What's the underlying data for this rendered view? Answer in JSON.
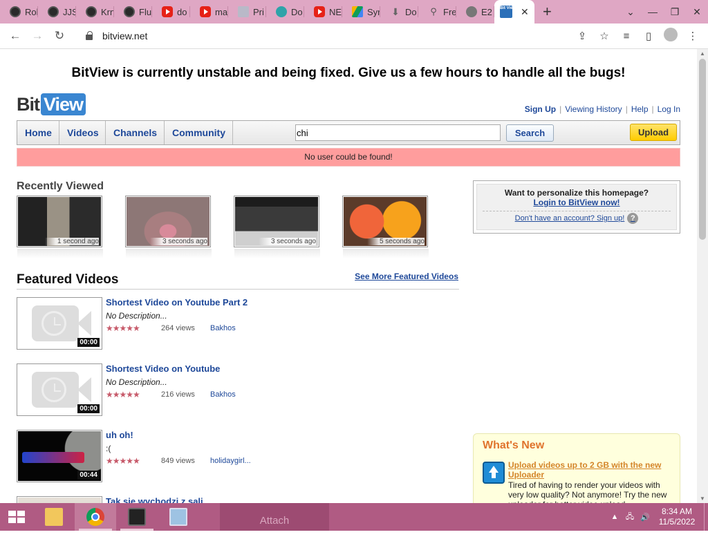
{
  "browser": {
    "tabs": [
      {
        "label": "Rol",
        "icon": "dark"
      },
      {
        "label": "JJS",
        "icon": "dark"
      },
      {
        "label": "Krn",
        "icon": "dark"
      },
      {
        "label": "Flu",
        "icon": "dark"
      },
      {
        "label": "do",
        "icon": "yt"
      },
      {
        "label": "ma",
        "icon": "yt"
      },
      {
        "label": "Pri",
        "icon": "doc"
      },
      {
        "label": "Do",
        "icon": "globe"
      },
      {
        "label": "NE",
        "icon": "yt"
      },
      {
        "label": "Syr",
        "icon": "drive"
      },
      {
        "label": "Do",
        "icon": "dl"
      },
      {
        "label": "Fre",
        "icon": "wp"
      },
      {
        "label": "E2",
        "icon": "grey"
      }
    ],
    "active_tab_icon_text": "Bit View",
    "url": "bitview.net"
  },
  "page": {
    "banner": "BitView is currently unstable and being fixed. Give us a few hours to handle all the bugs!",
    "logo": {
      "bit": "Bit",
      "view": "View"
    },
    "top_links": {
      "signup": "Sign Up",
      "history": "Viewing History",
      "help": "Help",
      "login": "Log In"
    },
    "nav": {
      "home": "Home",
      "videos": "Videos",
      "channels": "Channels",
      "community": "Community"
    },
    "search": {
      "value": "chi",
      "button": "Search"
    },
    "upload_label": "Upload",
    "error": "No user could be found!",
    "recently_viewed": {
      "title": "Recently Viewed",
      "items": [
        {
          "time": "1 second ago"
        },
        {
          "time": "3 seconds ago"
        },
        {
          "time": "3 seconds ago"
        },
        {
          "time": "5 seconds ago"
        }
      ]
    },
    "featured": {
      "title": "Featured Videos",
      "see_more": "See More Featured Videos",
      "videos": [
        {
          "title": "Shortest Video on Youtube Part 2",
          "description": "No Description...",
          "views": "264 views",
          "author": "Bakhos",
          "duration": "00:00",
          "rating": 5
        },
        {
          "title": "Shortest Video on Youtube",
          "description": "No Description...",
          "views": "216 views",
          "author": "Bakhos",
          "duration": "00:00",
          "rating": 5
        },
        {
          "title": "uh oh!",
          "description": ":(",
          "views": "849 views",
          "author": "holidaygirl...",
          "duration": "00:44",
          "rating": 4.5
        },
        {
          "title": "Tak sie wychodzi z sali",
          "description": "",
          "views": "",
          "author": "",
          "duration": "",
          "rating": 0
        }
      ]
    },
    "login_box": {
      "question": "Want to personalize this homepage?",
      "login_link": "Login to BitView now!",
      "signup_link": "Don't have an account? Sign up!",
      "help_glyph": "?"
    },
    "whats_new": {
      "title": "What's New",
      "link": "Upload videos up to 2 GB with the new Uploader",
      "text": "Tired of having to render your videos with very low quality? Not anymore! Try the new uploader for better video upload"
    }
  },
  "taskbar": {
    "attach_label": "Attach",
    "time": "8:34 AM",
    "date": "11/5/2022"
  }
}
